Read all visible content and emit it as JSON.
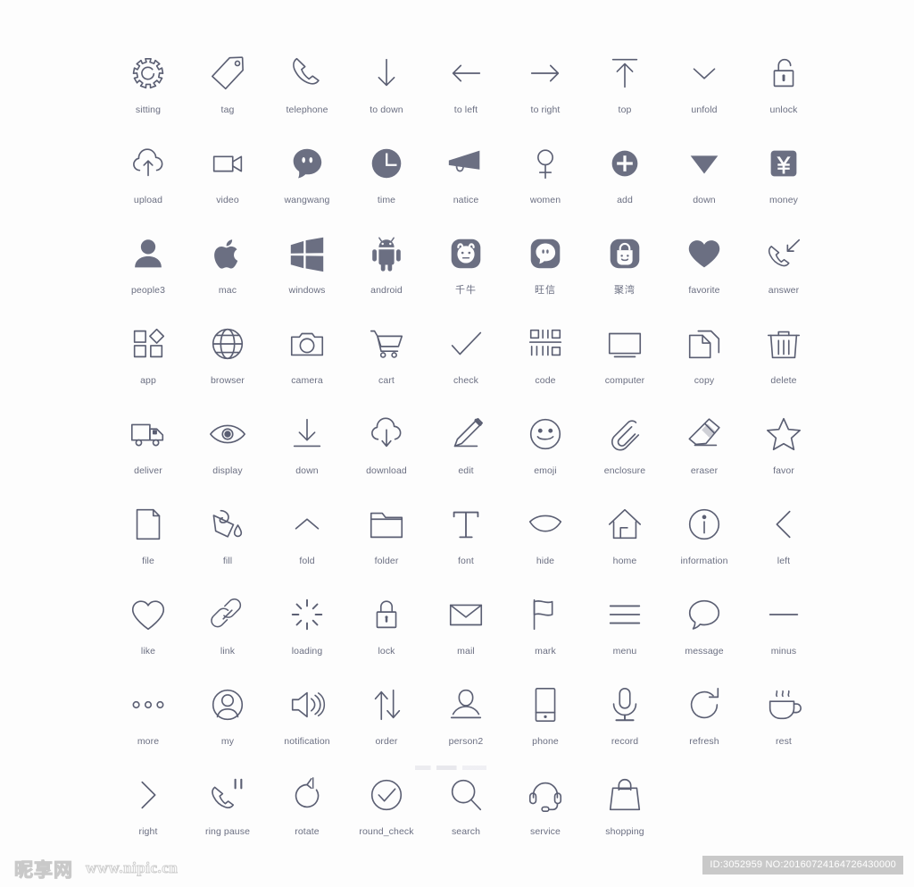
{
  "page": {
    "background": "#fdfdfd",
    "icon_stroke_color": "#5b5f73",
    "icon_fill_color": "#6b6f82",
    "label_color": "#6b6f82",
    "columns": 9,
    "rows": 9,
    "total_icons": 79
  },
  "footer": {
    "watermark_logo": "昵享网",
    "watermark_url": "www.nipic.cn",
    "id_badge": "ID:3052959 NO:20160724164726430000"
  },
  "icons": [
    {
      "label": "sitting",
      "icon": "gear-icon",
      "style": "line"
    },
    {
      "label": "tag",
      "icon": "tag-icon",
      "style": "line"
    },
    {
      "label": "telephone",
      "icon": "telephone-icon",
      "style": "line"
    },
    {
      "label": "to down",
      "icon": "arrow-down-icon",
      "style": "line"
    },
    {
      "label": "to left",
      "icon": "arrow-left-icon",
      "style": "line"
    },
    {
      "label": "to right",
      "icon": "arrow-right-icon",
      "style": "line"
    },
    {
      "label": "top",
      "icon": "arrow-to-top-icon",
      "style": "line"
    },
    {
      "label": "unfold",
      "icon": "chevron-down-icon",
      "style": "line"
    },
    {
      "label": "unlock",
      "icon": "unlock-icon",
      "style": "line"
    },
    {
      "label": "upload",
      "icon": "cloud-upload-icon",
      "style": "line"
    },
    {
      "label": "video",
      "icon": "video-camera-icon",
      "style": "line"
    },
    {
      "label": "wangwang",
      "icon": "wangwang-icon",
      "style": "solid"
    },
    {
      "label": "time",
      "icon": "clock-icon",
      "style": "solid"
    },
    {
      "label": "natice",
      "icon": "megaphone-icon",
      "style": "solid"
    },
    {
      "label": "women",
      "icon": "female-icon",
      "style": "line"
    },
    {
      "label": "add",
      "icon": "plus-circle-icon",
      "style": "solid"
    },
    {
      "label": "down",
      "icon": "triangle-down-icon",
      "style": "solid"
    },
    {
      "label": "money",
      "icon": "yen-money-icon",
      "style": "solid"
    },
    {
      "label": "people3",
      "icon": "user-avatar-icon",
      "style": "solid"
    },
    {
      "label": "mac",
      "icon": "apple-icon",
      "style": "solid"
    },
    {
      "label": "windows",
      "icon": "windows-icon",
      "style": "solid"
    },
    {
      "label": "android",
      "icon": "android-icon",
      "style": "solid"
    },
    {
      "label": "千牛",
      "icon": "qianniu-icon",
      "style": "solid"
    },
    {
      "label": "旺信",
      "icon": "wangxin-icon",
      "style": "solid"
    },
    {
      "label": "聚湾",
      "icon": "juwan-bag-icon",
      "style": "solid"
    },
    {
      "label": "favorite",
      "icon": "heart-filled-icon",
      "style": "solid"
    },
    {
      "label": "answer",
      "icon": "answer-call-icon",
      "style": "line"
    },
    {
      "label": "app",
      "icon": "app-grid-icon",
      "style": "line"
    },
    {
      "label": "browser",
      "icon": "globe-icon",
      "style": "line"
    },
    {
      "label": "camera",
      "icon": "camera-icon",
      "style": "line"
    },
    {
      "label": "cart",
      "icon": "cart-icon",
      "style": "line"
    },
    {
      "label": "check",
      "icon": "check-icon",
      "style": "line"
    },
    {
      "label": "code",
      "icon": "code-icon",
      "style": "line"
    },
    {
      "label": "computer",
      "icon": "monitor-icon",
      "style": "line"
    },
    {
      "label": "copy",
      "icon": "copy-icon",
      "style": "line"
    },
    {
      "label": "delete",
      "icon": "trash-icon",
      "style": "line"
    },
    {
      "label": "deliver",
      "icon": "truck-icon",
      "style": "line"
    },
    {
      "label": "display",
      "icon": "eye-icon",
      "style": "line"
    },
    {
      "label": "down",
      "icon": "download-bar-icon",
      "style": "line"
    },
    {
      "label": "download",
      "icon": "cloud-download-icon",
      "style": "line"
    },
    {
      "label": "edit",
      "icon": "pencil-icon",
      "style": "line"
    },
    {
      "label": "emoji",
      "icon": "smiley-icon",
      "style": "line"
    },
    {
      "label": "enclosure",
      "icon": "paperclip-icon",
      "style": "line"
    },
    {
      "label": "eraser",
      "icon": "eraser-icon",
      "style": "line"
    },
    {
      "label": "favor",
      "icon": "star-icon",
      "style": "line"
    },
    {
      "label": "file",
      "icon": "file-icon",
      "style": "line"
    },
    {
      "label": "fill",
      "icon": "paint-bucket-icon",
      "style": "line"
    },
    {
      "label": "fold",
      "icon": "chevron-up-icon",
      "style": "line"
    },
    {
      "label": "folder",
      "icon": "folder-icon",
      "style": "line"
    },
    {
      "label": "font",
      "icon": "font-t-icon",
      "style": "line"
    },
    {
      "label": "hide",
      "icon": "eye-closed-icon",
      "style": "line"
    },
    {
      "label": "home",
      "icon": "home-icon",
      "style": "line"
    },
    {
      "label": "information",
      "icon": "info-circle-icon",
      "style": "line"
    },
    {
      "label": "left",
      "icon": "chevron-left-icon",
      "style": "line"
    },
    {
      "label": "like",
      "icon": "heart-outline-icon",
      "style": "line"
    },
    {
      "label": "link",
      "icon": "link-icon",
      "style": "line"
    },
    {
      "label": "loading",
      "icon": "spinner-icon",
      "style": "line"
    },
    {
      "label": "lock",
      "icon": "lock-icon",
      "style": "line"
    },
    {
      "label": "mail",
      "icon": "mail-icon",
      "style": "line"
    },
    {
      "label": "mark",
      "icon": "flag-icon",
      "style": "line"
    },
    {
      "label": "menu",
      "icon": "hamburger-menu-icon",
      "style": "line"
    },
    {
      "label": "message",
      "icon": "speech-bubble-icon",
      "style": "line"
    },
    {
      "label": "minus",
      "icon": "minus-icon",
      "style": "line"
    },
    {
      "label": "more",
      "icon": "ellipsis-icon",
      "style": "line"
    },
    {
      "label": "my",
      "icon": "user-circle-icon",
      "style": "line"
    },
    {
      "label": "notification",
      "icon": "speaker-icon",
      "style": "line"
    },
    {
      "label": "order",
      "icon": "sort-arrows-icon",
      "style": "line"
    },
    {
      "label": "person2",
      "icon": "person-icon",
      "style": "line"
    },
    {
      "label": "phone",
      "icon": "mobile-phone-icon",
      "style": "line"
    },
    {
      "label": "record",
      "icon": "microphone-icon",
      "style": "line"
    },
    {
      "label": "refresh",
      "icon": "refresh-icon",
      "style": "line"
    },
    {
      "label": "rest",
      "icon": "coffee-cup-icon",
      "style": "line"
    },
    {
      "label": "right",
      "icon": "chevron-right-icon",
      "style": "line"
    },
    {
      "label": "ring pause",
      "icon": "call-pause-icon",
      "style": "line"
    },
    {
      "label": "rotate",
      "icon": "rotate-icon",
      "style": "line"
    },
    {
      "label": "round_check",
      "icon": "check-circle-icon",
      "style": "line"
    },
    {
      "label": "search",
      "icon": "search-icon",
      "style": "line"
    },
    {
      "label": "service",
      "icon": "headset-icon",
      "style": "line"
    },
    {
      "label": "shopping",
      "icon": "shopping-bag-icon",
      "style": "line"
    }
  ]
}
